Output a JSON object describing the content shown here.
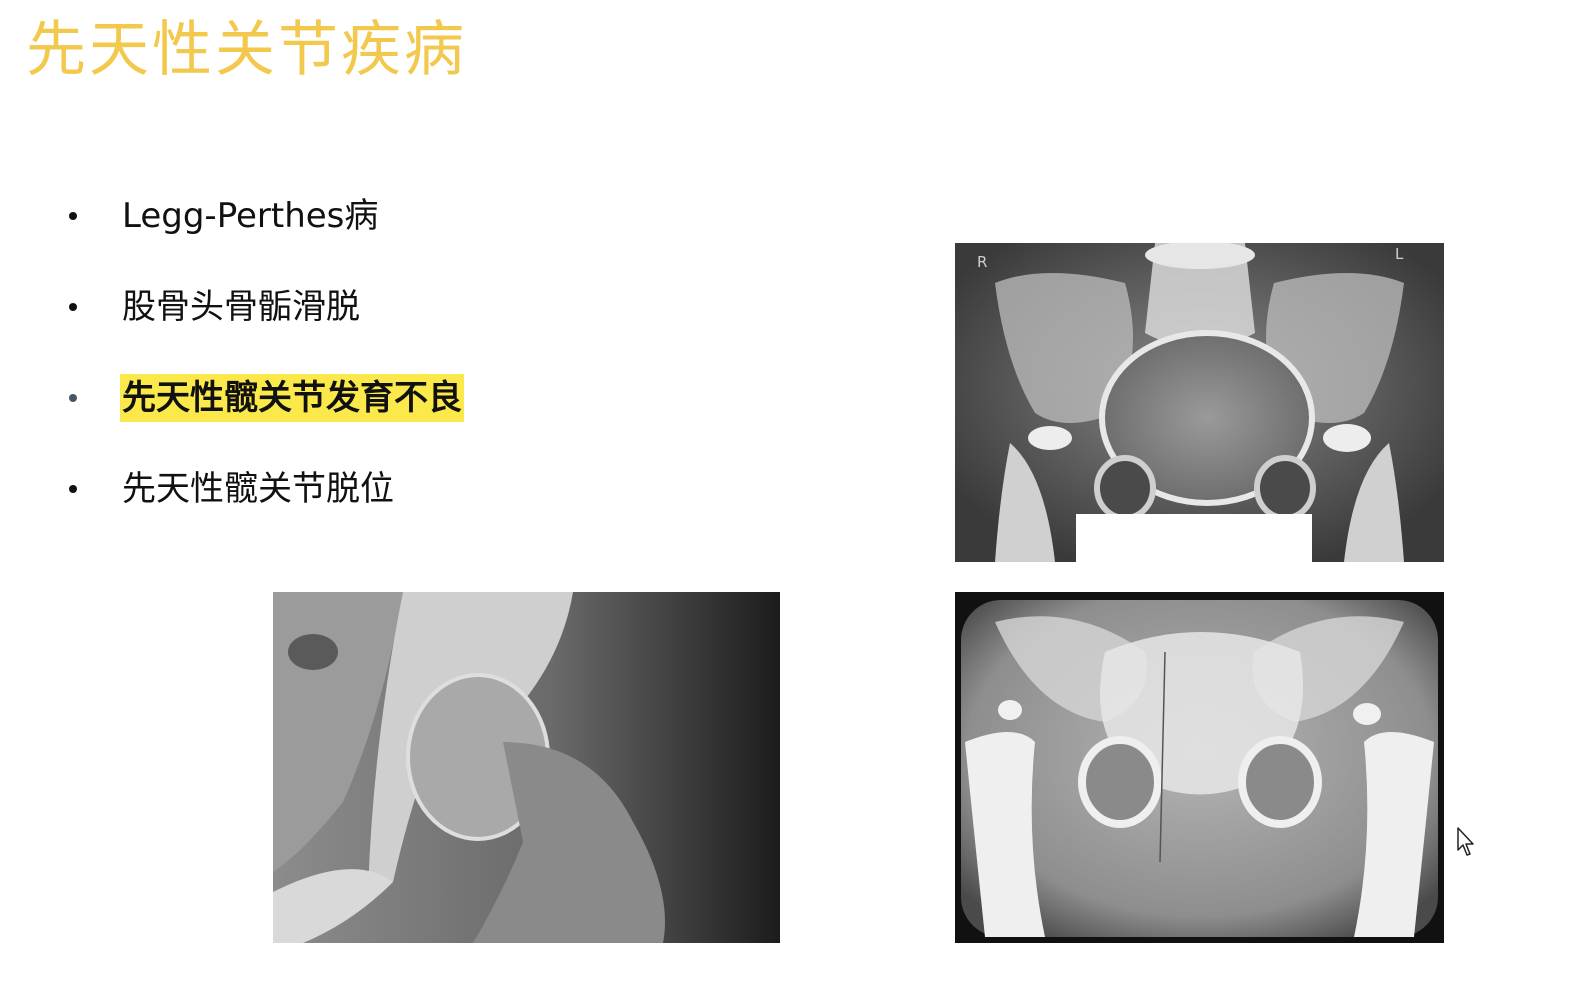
{
  "slide": {
    "title": "先天性关节疾病",
    "title_color": "#f2c94c",
    "highlight_color": "#fbe84a"
  },
  "bullets": [
    {
      "label": "Legg-Perthes病",
      "highlighted": false
    },
    {
      "label": "股骨头骨骺滑脱",
      "highlighted": false
    },
    {
      "label": "先天性髋关节发育不良",
      "highlighted": true
    },
    {
      "label": "先天性髋关节脱位",
      "highlighted": false
    }
  ],
  "images": {
    "pelvis_top": {
      "side_right": "R",
      "side_left": "L"
    }
  }
}
